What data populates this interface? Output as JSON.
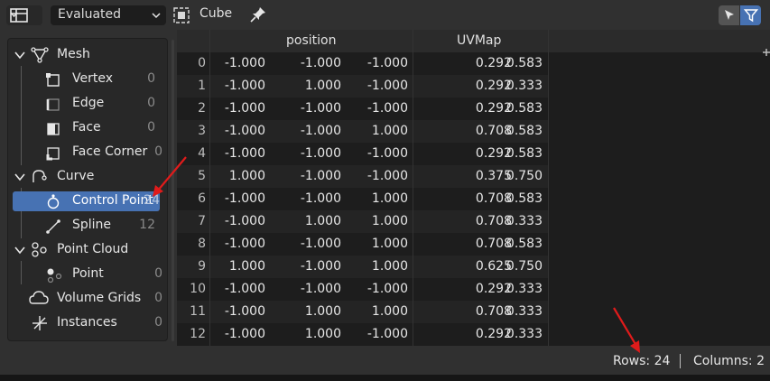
{
  "header": {
    "mode_value": "Evaluated",
    "object_name": "Cube"
  },
  "colors": {
    "accent": "#4772b3",
    "annotation_arrow": "#e01b1b"
  },
  "tree": {
    "groups": [
      {
        "label": "Mesh",
        "icon": "mesh-icon"
      },
      {
        "label": "Curve",
        "icon": "curve-icon"
      },
      {
        "label": "Point Cloud",
        "icon": "point-cloud-icon"
      }
    ],
    "items": [
      {
        "label": "Vertex",
        "count": "0",
        "icon": "vertex-icon"
      },
      {
        "label": "Edge",
        "count": "0",
        "icon": "edge-icon"
      },
      {
        "label": "Face",
        "count": "0",
        "icon": "face-icon"
      },
      {
        "label": "Face Corner",
        "count": "0",
        "icon": "face-corner-icon"
      },
      {
        "label": "Control Point",
        "count": "24",
        "icon": "control-point-icon",
        "selected": true
      },
      {
        "label": "Spline",
        "count": "12",
        "icon": "spline-icon"
      },
      {
        "label": "Point",
        "count": "0",
        "icon": "point-icon"
      },
      {
        "label": "Volume Grids",
        "count": "0",
        "icon": "volume-icon"
      },
      {
        "label": "Instances",
        "count": "0",
        "icon": "instances-icon"
      }
    ]
  },
  "table": {
    "columns": [
      {
        "name": "position"
      },
      {
        "name": "UVMap"
      }
    ],
    "rows": [
      {
        "i": "0",
        "v": [
          "-1.000",
          "-1.000",
          "-1.000",
          "0.292",
          "0.583"
        ]
      },
      {
        "i": "1",
        "v": [
          "-1.000",
          "1.000",
          "-1.000",
          "0.292",
          "0.333"
        ]
      },
      {
        "i": "2",
        "v": [
          "-1.000",
          "-1.000",
          "-1.000",
          "0.292",
          "0.583"
        ]
      },
      {
        "i": "3",
        "v": [
          "-1.000",
          "-1.000",
          "1.000",
          "0.708",
          "0.583"
        ]
      },
      {
        "i": "4",
        "v": [
          "-1.000",
          "-1.000",
          "-1.000",
          "0.292",
          "0.583"
        ]
      },
      {
        "i": "5",
        "v": [
          "1.000",
          "-1.000",
          "-1.000",
          "0.375",
          "0.750"
        ]
      },
      {
        "i": "6",
        "v": [
          "-1.000",
          "-1.000",
          "1.000",
          "0.708",
          "0.583"
        ]
      },
      {
        "i": "7",
        "v": [
          "-1.000",
          "1.000",
          "1.000",
          "0.708",
          "0.333"
        ]
      },
      {
        "i": "8",
        "v": [
          "-1.000",
          "-1.000",
          "1.000",
          "0.708",
          "0.583"
        ]
      },
      {
        "i": "9",
        "v": [
          "1.000",
          "-1.000",
          "1.000",
          "0.625",
          "0.750"
        ]
      },
      {
        "i": "10",
        "v": [
          "-1.000",
          "-1.000",
          "-1.000",
          "0.292",
          "0.333"
        ]
      },
      {
        "i": "11",
        "v": [
          "-1.000",
          "1.000",
          "1.000",
          "0.708",
          "0.333"
        ]
      },
      {
        "i": "12",
        "v": [
          "-1.000",
          "1.000",
          "-1.000",
          "0.292",
          "0.333"
        ]
      }
    ]
  },
  "footer": {
    "rows_text": "Rows: 24",
    "columns_text": "Columns: 2"
  }
}
